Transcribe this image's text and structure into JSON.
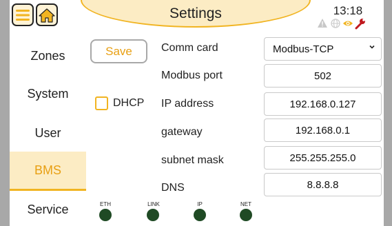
{
  "header": {
    "title": "Settings",
    "time": "13:18",
    "icons": [
      "menu-icon",
      "home-icon",
      "warning-icon",
      "globe-icon",
      "eye-icon",
      "wrench-icon"
    ]
  },
  "colors": {
    "accent": "#f1b421",
    "accent_text": "#e89f12",
    "active_bg": "#fcecc4",
    "led": "#1f4a24",
    "wrench": "#c0181e"
  },
  "sidebar": {
    "items": [
      {
        "label": "Zones",
        "active": false
      },
      {
        "label": "System",
        "active": false
      },
      {
        "label": "User",
        "active": false
      },
      {
        "label": "BMS",
        "active": true
      },
      {
        "label": "Service",
        "active": false
      }
    ]
  },
  "actions": {
    "save_label": "Save"
  },
  "dhcp": {
    "label": "DHCP",
    "checked": false
  },
  "fields": [
    {
      "label": "Comm card",
      "value": "Modbus-TCP",
      "type": "select"
    },
    {
      "label": "Modbus port",
      "value": "502",
      "type": "text"
    },
    {
      "label": "IP address",
      "value": "192.168.0.127",
      "type": "text"
    },
    {
      "label": "gateway",
      "value": "192.168.0.1",
      "type": "text"
    },
    {
      "label": "subnet mask",
      "value": "255.255.255.0",
      "type": "text"
    },
    {
      "label": "DNS",
      "value": "8.8.8.8",
      "type": "text"
    }
  ],
  "leds": [
    {
      "label": "ETH"
    },
    {
      "label": "LINK"
    },
    {
      "label": "IP"
    },
    {
      "label": "NET"
    }
  ]
}
